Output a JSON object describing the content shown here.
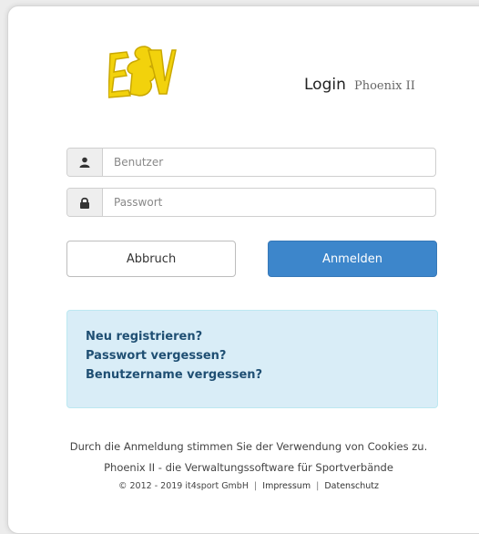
{
  "brand": {
    "logo_text": "BV",
    "logo_color": "#f2d20c"
  },
  "header": {
    "title": "Login",
    "subtitle": "Phoenix II"
  },
  "form": {
    "username": {
      "placeholder": "Benutzer",
      "value": "",
      "icon": "user-icon"
    },
    "password": {
      "placeholder": "Passwort",
      "value": "",
      "icon": "lock-icon"
    }
  },
  "buttons": {
    "cancel_label": "Abbruch",
    "login_label": "Anmelden"
  },
  "links": {
    "register": "Neu registrieren?",
    "forgot_password": "Passwort vergessen?",
    "forgot_username": "Benutzername vergessen?"
  },
  "footer": {
    "cookie_notice": "Durch die Anmeldung stimmen Sie der Verwendung von Cookies zu.",
    "tagline": "Phoenix II - die Verwaltungssoftware für Sportverbände",
    "copyright": "© 2012 - 2019 it4sport GmbH",
    "imprint": "Impressum",
    "privacy": "Datenschutz"
  },
  "colors": {
    "primary": "#3d86cb",
    "info_bg": "#d9edf7",
    "info_link": "#1f4f73"
  }
}
